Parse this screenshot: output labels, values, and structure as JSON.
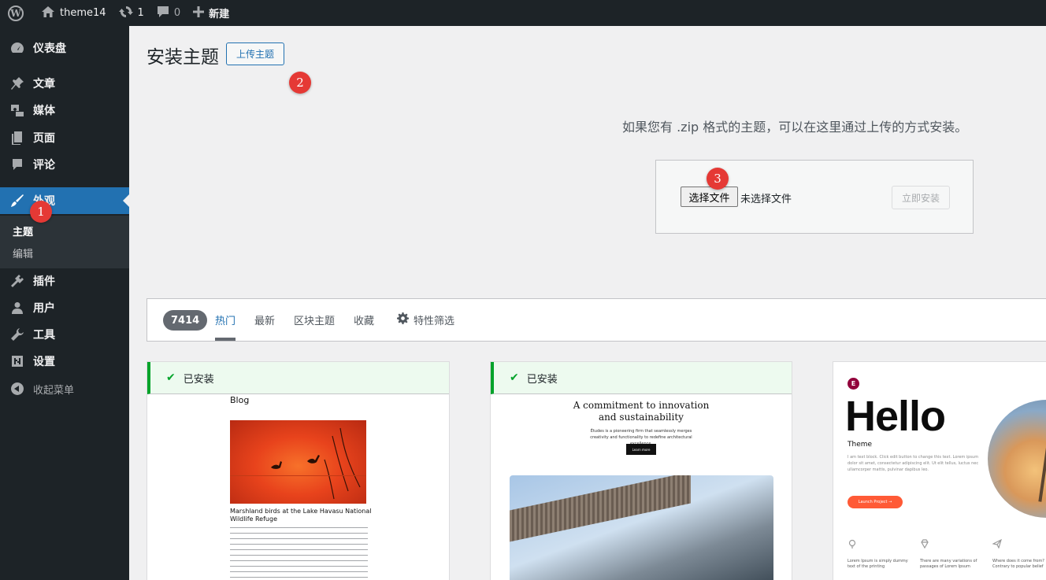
{
  "adminbar": {
    "site_name": "theme14",
    "updates_count": "1",
    "comments_count": "0",
    "new_label": "新建"
  },
  "sidebar": {
    "items": [
      {
        "label": "仪表盘",
        "icon": "dashboard-icon"
      },
      {
        "label": "文章",
        "icon": "pin-icon"
      },
      {
        "label": "媒体",
        "icon": "media-icon"
      },
      {
        "label": "页面",
        "icon": "page-icon"
      },
      {
        "label": "评论",
        "icon": "comment-icon"
      },
      {
        "label": "外观",
        "icon": "appearance-brush-icon",
        "current": true
      },
      {
        "label": "插件",
        "icon": "plugin-icon"
      },
      {
        "label": "用户",
        "icon": "user-icon"
      },
      {
        "label": "工具",
        "icon": "wrench-icon"
      },
      {
        "label": "设置",
        "icon": "settings-icon"
      }
    ],
    "submenu": [
      {
        "label": "主题",
        "current": true
      },
      {
        "label": "编辑"
      }
    ],
    "collapse_label": "收起菜单"
  },
  "header": {
    "title": "安装主题",
    "upload_button": "上传主题"
  },
  "markers": [
    "1",
    "2",
    "3"
  ],
  "upload": {
    "help_text": "如果您有 .zip 格式的主题，可以在这里通过上传的方式安装。",
    "choose_file": "选择文件",
    "no_file": "未选择文件",
    "install_now": "立即安装"
  },
  "filter": {
    "count": "7414",
    "tabs": [
      "热门",
      "最新",
      "区块主题",
      "收藏"
    ],
    "feature_filter": "特性筛选"
  },
  "themes": [
    {
      "installed": "已安装",
      "preview": {
        "blog": "Blog",
        "caption": "Marshland birds at the Lake Havasu National Wildlife Refuge"
      }
    },
    {
      "installed": "已安装",
      "preview": {
        "headline": "A commitment to innovation and sustainability",
        "sub": "Études is a pioneering firm that seamlessly merges creativity and functionality to redefine architectural excellence.",
        "button": "Learn more"
      }
    },
    {
      "preview": {
        "hello": "Hello",
        "theme": "Theme",
        "desc": "I am text block. Click edit button to change this text. Lorem ipsum dolor sit amet, consectetur adipiscing elit. Ut elit tellus, luctus nec ullamcorper mattis, pulvinar dapibus leo.",
        "button": "Launch Project →",
        "features": [
          "Lorem Ipsum is simply dummy text of the printing",
          "There are many variations of passages of Lorem Ipsum",
          "Where does it come from? Contrary to popular belief"
        ]
      }
    }
  ],
  "colors": {
    "adminbar_bg": "#1d2327",
    "accent": "#2271b1",
    "installed_green": "#00a32a",
    "marker_red": "#e53935"
  }
}
